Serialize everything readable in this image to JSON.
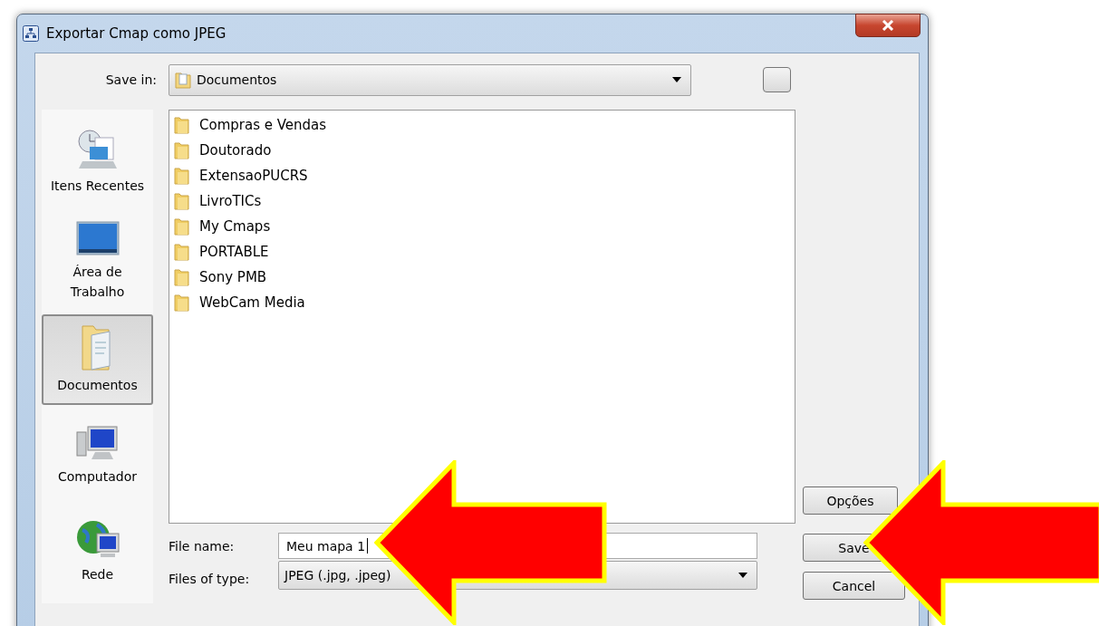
{
  "window": {
    "title": "Exportar Cmap como JPEG"
  },
  "save_in": {
    "label": "Save in:",
    "value": "Documentos"
  },
  "sidebar": {
    "items": [
      {
        "label": "Itens Recentes",
        "kind": "recent",
        "selected": false
      },
      {
        "label": "Área de Trabalho",
        "kind": "desktop",
        "selected": false
      },
      {
        "label": "Documentos",
        "kind": "documents",
        "selected": true
      },
      {
        "label": "Computador",
        "kind": "computer",
        "selected": false
      },
      {
        "label": "Rede",
        "kind": "network",
        "selected": false
      }
    ]
  },
  "files": [
    "Compras e Vendas",
    "Doutorado",
    "ExtensaoPUCRS",
    "LivroTICs",
    "My Cmaps",
    "PORTABLE",
    "Sony PMB",
    "WebCam Media"
  ],
  "file_name": {
    "label": "File name:",
    "value": "Meu mapa 1"
  },
  "file_type": {
    "label": "Files of type:",
    "value": "JPEG (.jpg, .jpeg)"
  },
  "buttons": {
    "options": "Opções",
    "save": "Save",
    "cancel": "Cancel"
  }
}
